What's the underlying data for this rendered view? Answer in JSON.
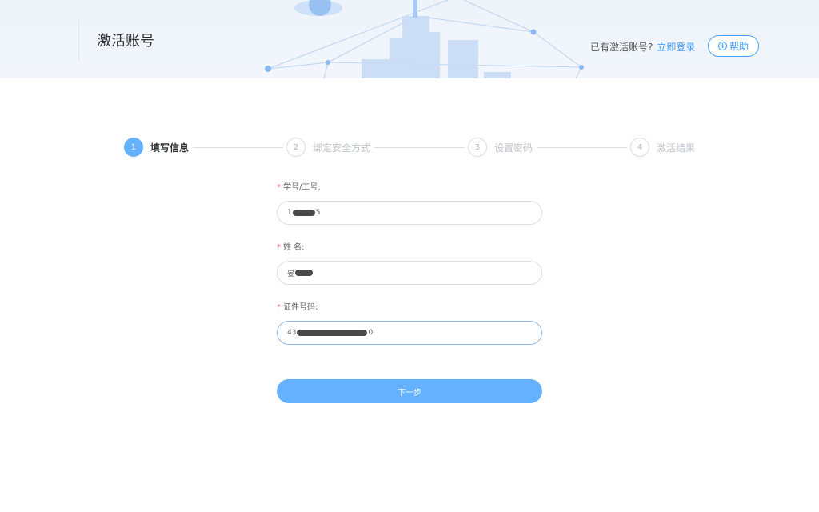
{
  "header": {
    "title": "激活账号",
    "login_hint": "已有激活账号?",
    "login_link": "立即登录",
    "help_label": "帮助",
    "help_icon_glyph": "i"
  },
  "steps": [
    {
      "number": "1",
      "label": "填写信息",
      "active": true
    },
    {
      "number": "2",
      "label": "绑定安全方式",
      "active": false
    },
    {
      "number": "3",
      "label": "设置密码",
      "active": false
    },
    {
      "number": "4",
      "label": "激活结果",
      "active": false
    }
  ],
  "form": {
    "student_id": {
      "label": "学号/工号:",
      "required_mark": "*",
      "value_prefix": "1",
      "value_suffix": "5"
    },
    "name": {
      "label": "姓 名:",
      "required_mark": "*",
      "value_prefix": "晏",
      "value_suffix": ""
    },
    "id_number": {
      "label": "证件号码:",
      "required_mark": "*",
      "value_prefix": "43",
      "value_suffix": "0"
    },
    "next_button": "下一步"
  },
  "colors": {
    "primary": "#409eff",
    "primary_light": "#66b1ff",
    "required": "#f56c6c"
  }
}
